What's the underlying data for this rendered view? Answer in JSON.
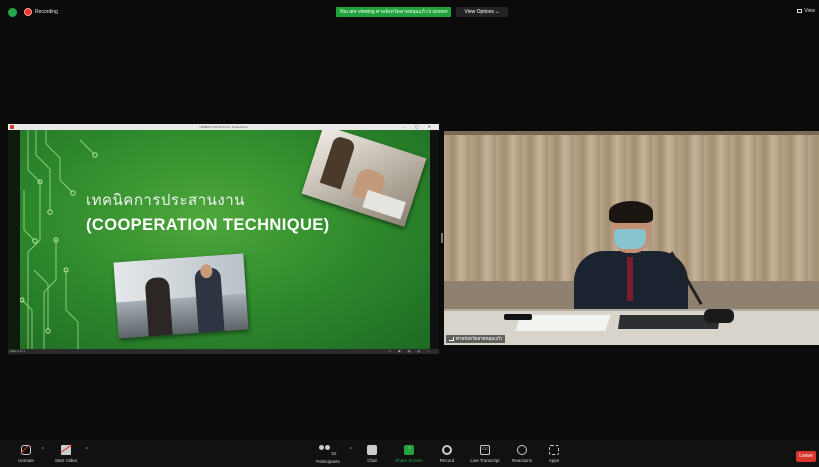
{
  "topbar": {
    "recording_label": "Recording",
    "viewing_banner": "You are viewing ศาลจังหวัดลาดหลุมแก้ว's screen",
    "view_options_label": "View Options ⌄",
    "view_label": "View"
  },
  "share": {
    "window_title": "เทคนิคการประสานงาน - PowerPoint",
    "slide_title_th": "เทคนิคการประสานงาน",
    "slide_title_en": "(COOPERATION TECHNIQUE)",
    "status_left": "Slide 1 of 1",
    "status_right": "▭ ▣ ▤ ▥ —"
  },
  "video": {
    "participant_name": "ศาลจังหวัดลาดหลุมแก้ว"
  },
  "toolbar": {
    "unmute": "Unmute",
    "start_video": "Start Video",
    "participants": "Participants",
    "participants_count": "52",
    "chat": "Chat",
    "share_screen": "Share Screen",
    "record": "Record",
    "live_transcript": "Live Transcript",
    "reactions": "Reactions",
    "apps": "Apps",
    "leave": "Leave",
    "caret": "^"
  },
  "colors": {
    "background": "#0b0b0b",
    "share_green": "#20a33b",
    "leave_red": "#d9362b",
    "recording_red": "#e0362c"
  }
}
